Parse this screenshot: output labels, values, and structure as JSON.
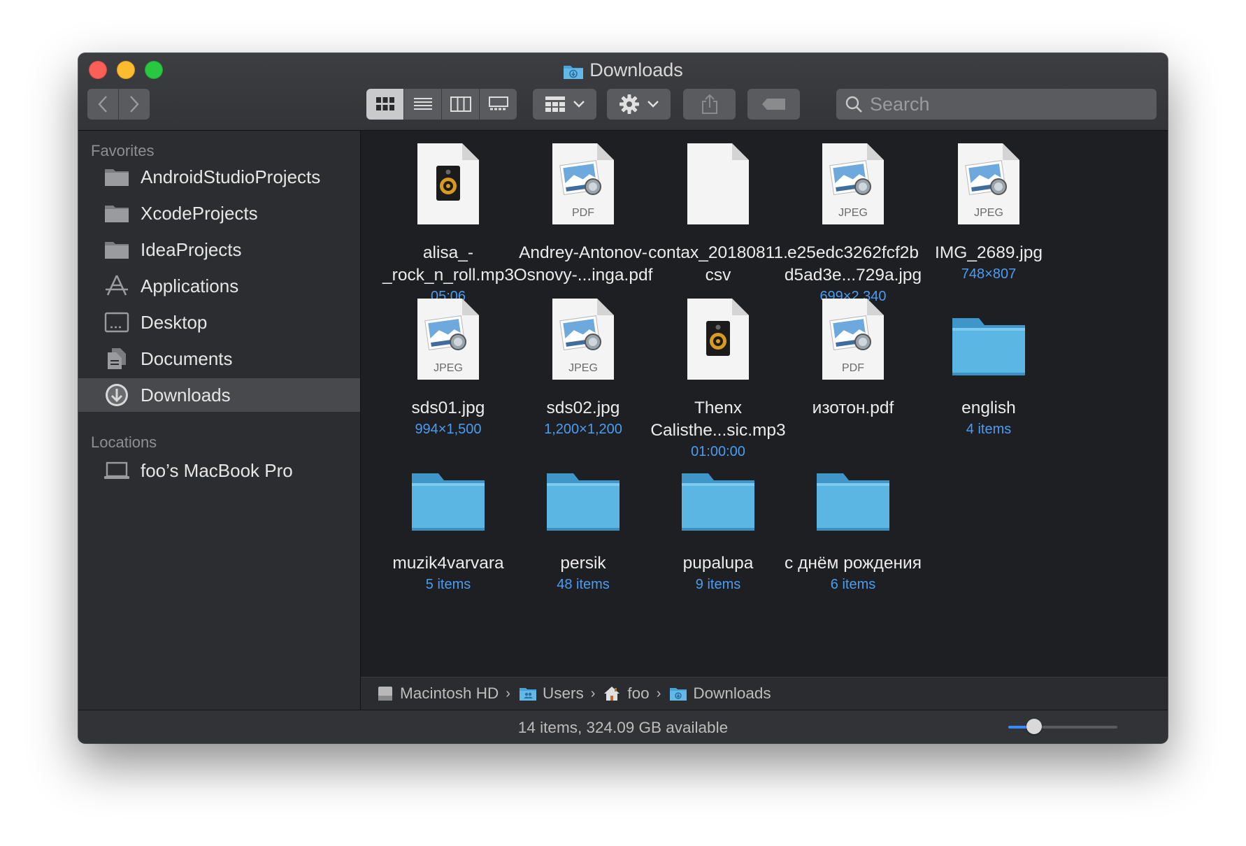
{
  "window": {
    "title": "Downloads"
  },
  "toolbar": {
    "back_icon": "chevron-left-icon",
    "forward_icon": "chevron-right-icon",
    "views": [
      "icon-view",
      "list-view",
      "column-view",
      "gallery-view"
    ],
    "active_view": "icon-view",
    "group_icon": "grid-icon",
    "action_icon": "gear-icon",
    "share_icon": "share-icon",
    "tag_icon": "tag-icon",
    "search_placeholder": "Search"
  },
  "sidebar": {
    "favorites_title": "Favorites",
    "favorites": [
      {
        "label": "AndroidStudioProjects",
        "icon": "folder-icon"
      },
      {
        "label": "XcodeProjects",
        "icon": "folder-icon"
      },
      {
        "label": "IdeaProjects",
        "icon": "folder-icon"
      },
      {
        "label": "Applications",
        "icon": "applications-icon"
      },
      {
        "label": "Desktop",
        "icon": "desktop-icon"
      },
      {
        "label": "Documents",
        "icon": "documents-icon"
      },
      {
        "label": "Downloads",
        "icon": "downloads-icon",
        "selected": true
      }
    ],
    "locations_title": "Locations",
    "locations": [
      {
        "label": "foo’s MacBook Pro",
        "icon": "laptop-icon"
      }
    ]
  },
  "files": [
    {
      "name": "alisa_-\n_rock_n_roll.mp3",
      "meta": "05:06",
      "kind": "audio"
    },
    {
      "name": "Andrey-Antonov-\nOsnovy-...inga.pdf",
      "meta": "",
      "kind": "pdf",
      "badge": "PDF"
    },
    {
      "name": "contax_20180811.\ncsv",
      "meta": "",
      "kind": "blank"
    },
    {
      "name": "e25edc3262fcf2b\nd5ad3e...729a.jpg",
      "meta": "699×2,340",
      "kind": "image",
      "badge": "JPEG"
    },
    {
      "name": "IMG_2689.jpg",
      "meta": "748×807",
      "kind": "image",
      "badge": "JPEG"
    },
    {
      "name": "sds01.jpg",
      "meta": "994×1,500",
      "kind": "image",
      "badge": "JPEG"
    },
    {
      "name": "sds02.jpg",
      "meta": "1,200×1,200",
      "kind": "image",
      "badge": "JPEG"
    },
    {
      "name": "Thenx\nCalisthe...sic.mp3",
      "meta": "01:00:00",
      "kind": "audio"
    },
    {
      "name": "изотон.pdf",
      "meta": "",
      "kind": "pdf",
      "badge": "PDF"
    },
    {
      "name": "english",
      "meta": "4 items",
      "kind": "folder"
    },
    {
      "name": "muzik4varvara",
      "meta": "5 items",
      "kind": "folder"
    },
    {
      "name": "persik",
      "meta": "48 items",
      "kind": "folder"
    },
    {
      "name": "pupalupa",
      "meta": "9 items",
      "kind": "folder"
    },
    {
      "name": "с днём рождения",
      "meta": "6 items",
      "kind": "folder"
    }
  ],
  "pathbar": [
    {
      "label": "Macintosh HD",
      "icon": "hard-drive-icon"
    },
    {
      "label": "Users",
      "icon": "users-folder-icon"
    },
    {
      "label": "foo",
      "icon": "home-icon"
    },
    {
      "label": "Downloads",
      "icon": "downloads-folder-icon"
    }
  ],
  "status": {
    "text": "14 items, 324.09 GB available",
    "icon_size_level": 0.24
  },
  "colors": {
    "accent": "#3d8af7",
    "meta_text": "#4a9df2",
    "folder": "#5cb6e3",
    "window_bg": "#1e1f22",
    "sidebar_bg": "#2c2d30"
  }
}
